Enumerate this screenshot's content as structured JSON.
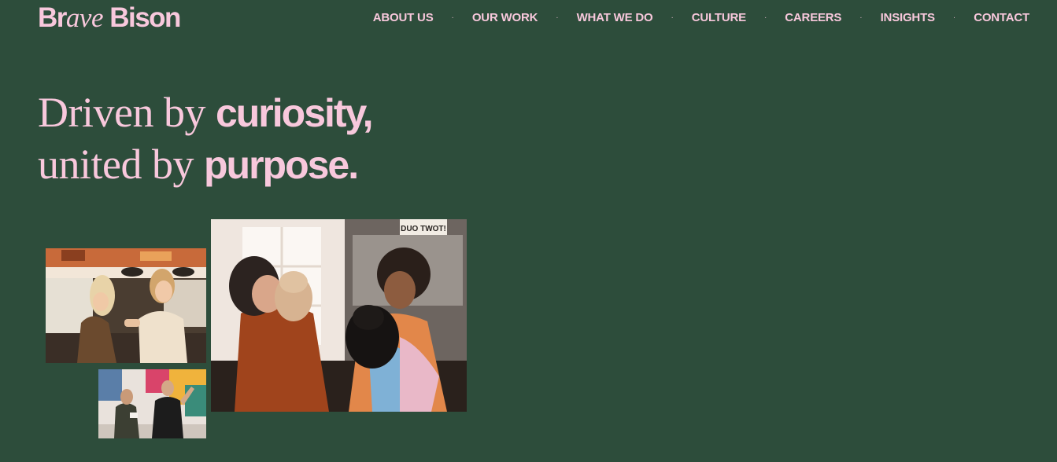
{
  "brand": {
    "logo_part1": "Br",
    "logo_italic": "ave",
    "logo_part2": " Bison",
    "accent_color": "#f8c8dc",
    "background_color": "#2d4d3b"
  },
  "nav": {
    "items": [
      {
        "label": "ABOUT US"
      },
      {
        "label": "OUR WORK"
      },
      {
        "label": "WHAT WE DO"
      },
      {
        "label": "CULTURE"
      },
      {
        "label": "CAREERS"
      },
      {
        "label": "INSIGHTS"
      },
      {
        "label": "CONTACT"
      }
    ],
    "separator": "·"
  },
  "hero": {
    "line1_regular": "Driven by ",
    "line1_bold": "curiosity,",
    "line2_regular": "united by ",
    "line2_bold": "purpose."
  },
  "photos": {
    "main_sign_text": "DUO TWOT!"
  }
}
